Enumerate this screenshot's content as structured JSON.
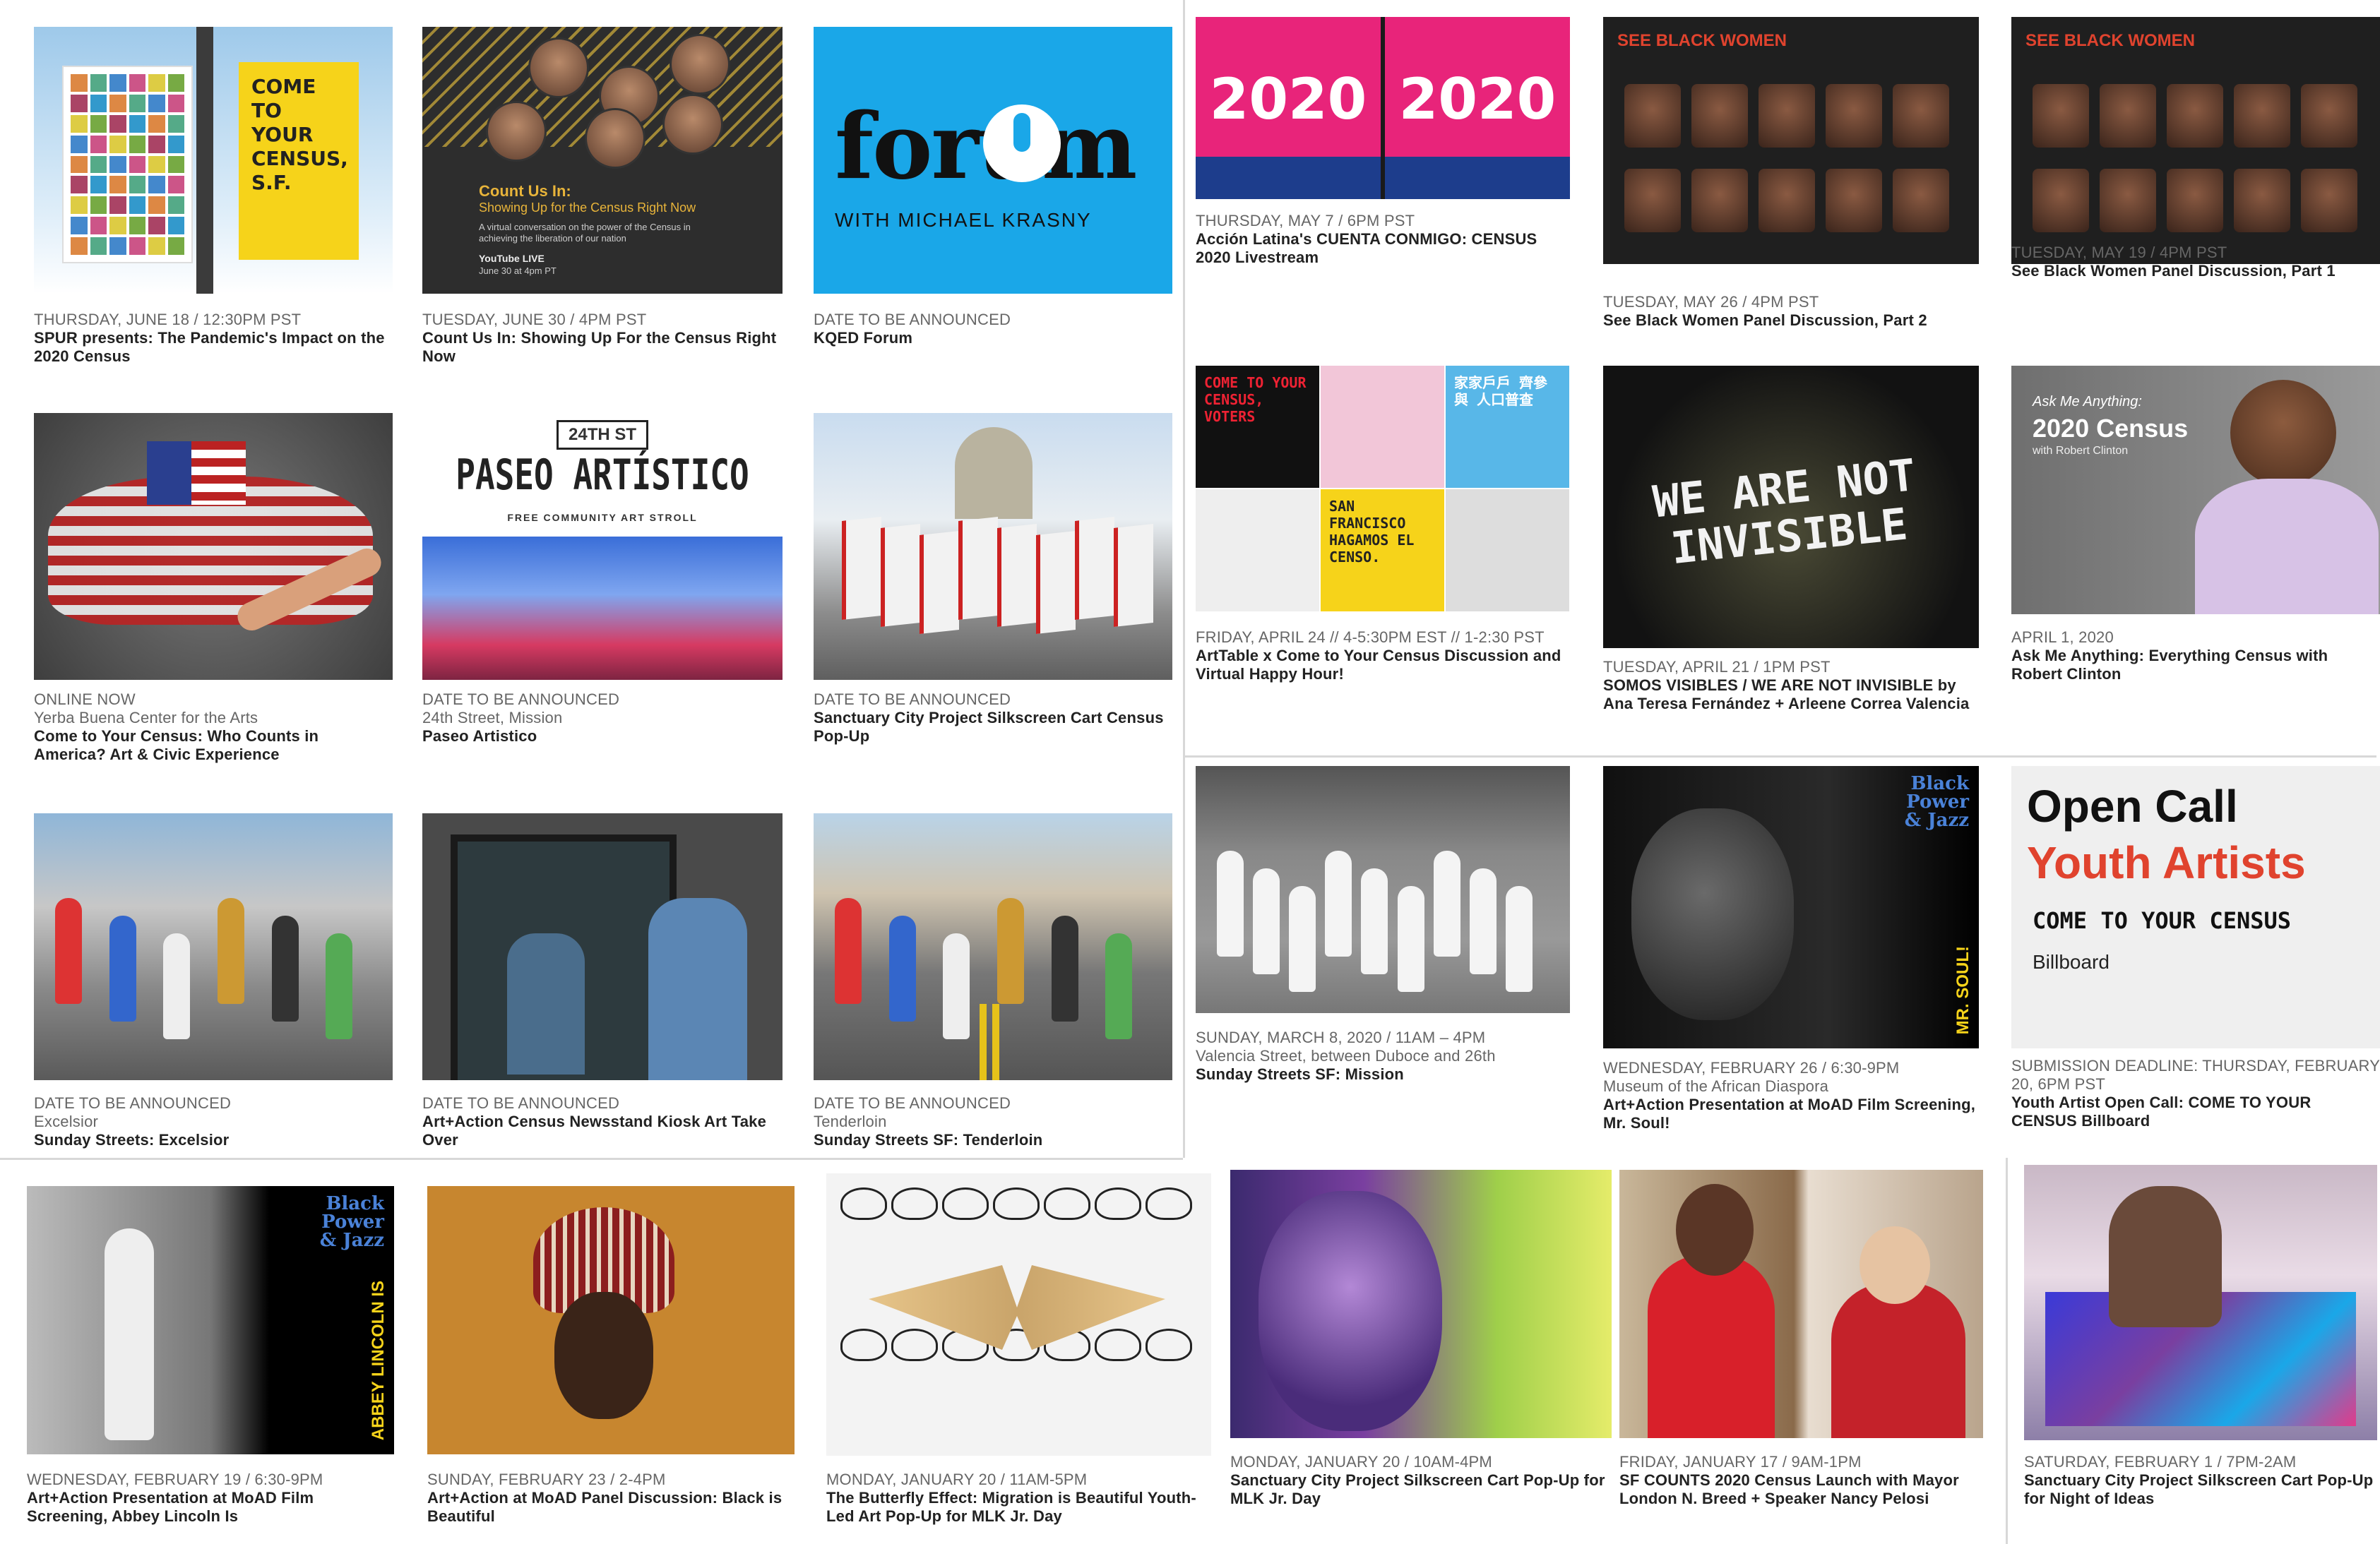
{
  "colors": {
    "kqed_blue": "#1aa7e8",
    "dark": "#2a2a2a",
    "pink": "#e02a6f",
    "yellow": "#f6d31a",
    "orange": "#c7862f"
  },
  "cards": [
    {
      "id": "spur",
      "date": "THURSDAY, JUNE 18 / 12:30PM PST",
      "loc": "",
      "title": "SPUR presents: The Pandemic's Impact on the 2020 Census",
      "thumb": {
        "type": "banner",
        "text": "COME TO YOUR CENSUS, S.F."
      }
    },
    {
      "id": "countus",
      "date": "TUESDAY, JUNE 30 / 4PM PST",
      "loc": "",
      "title": "Count Us In: Showing Up For the Census Right Now",
      "thumb": {
        "type": "countus",
        "heading": "Count Us In:",
        "sub": "Showing Up for the Census Right Now",
        "body": "A virtual conversation on the power of the Census in achieving the liberation of our nation",
        "footer1": "YouTube LIVE",
        "footer2": "June 30 at 4pm PT"
      }
    },
    {
      "id": "forum",
      "date": "DATE TO BE ANNOUNCED",
      "loc": "",
      "title": "KQED Forum",
      "thumb": {
        "type": "forum",
        "logo": "forum",
        "sub": "WITH MICHAEL KRASNY"
      }
    },
    {
      "id": "accion",
      "date": "THURSDAY, MAY 7 / 6PM PST",
      "loc": "",
      "title": "Acción Latina's CUENTA CONMIGO: CENSUS 2020 Livestream",
      "thumb": {
        "type": "accion",
        "text": "2020"
      }
    },
    {
      "id": "blackwomen2",
      "date": "TUESDAY, MAY 26 / 4PM PST",
      "loc": "",
      "title": "See Black Women Panel Discussion, Part 2",
      "thumb": {
        "type": "blackwomen",
        "heading": "SEE BLACK WOMEN"
      }
    },
    {
      "id": "blackwomen1",
      "date": "TUESDAY, MAY 19 / 4PM PST",
      "loc": "",
      "title": "See Black Women Panel Discussion, Part 1",
      "thumb": {
        "type": "blackwomen",
        "heading": "SEE BLACK WOMEN"
      }
    },
    {
      "id": "flags",
      "date": "ONLINE NOW",
      "loc": "Yerba Buena Center for the Arts",
      "title": "Come to Your Census: Who Counts in America? Art & Civic Experience",
      "thumb": {
        "type": "flags"
      }
    },
    {
      "id": "paseo",
      "date": "DATE TO BE ANNOUNCED",
      "loc": "24th Street, Mission",
      "title": "Paseo Artistico",
      "thumb": {
        "type": "paseo",
        "badge": "24TH ST",
        "heading": "PASEO ARTÍSTICO",
        "sub": "FREE COMMUNITY ART STROLL"
      }
    },
    {
      "id": "silkcart",
      "date": "DATE TO BE ANNOUNCED",
      "loc": "",
      "title": "Sanctuary City Project Silkscreen Cart Census Pop-Up",
      "thumb": {
        "type": "cityhall"
      }
    },
    {
      "id": "arttable",
      "date": "FRIDAY, APRIL 24 // 4-5:30PM EST // 1-2:30 PST",
      "loc": "",
      "title": "ArtTable x Come to Your Census Discussion and Virtual Happy Hour!",
      "thumb": {
        "type": "arttable",
        "t1": "COME TO YOUR CENSUS, VOTERS",
        "t2": "SAN FRANCISCO HAGAMOS EL CENSO.",
        "t3": "家家戶戶 齊參與 人口普查"
      }
    },
    {
      "id": "invisible",
      "date": "TUESDAY, APRIL 21 / 1PM PST",
      "loc": "",
      "title": "SOMOS VISIBLES / WE ARE NOT INVISIBLE by Ana Teresa Fernández + Arleene Correa Valencia",
      "thumb": {
        "type": "invisible",
        "text": "WE ARE NOT INVISIBLE"
      }
    },
    {
      "id": "ama",
      "date": "APRIL 1, 2020",
      "loc": "",
      "title": "Ask Me Anything: Everything Census with Robert Clinton",
      "thumb": {
        "type": "ama",
        "t1": "Ask Me Anything:",
        "t2": "2020 Census",
        "t3": "with Robert Clinton"
      }
    },
    {
      "id": "pedicab",
      "date": "DATE TO BE ANNOUNCED",
      "loc": "Excelsior",
      "title": "Sunday Streets: Excelsior",
      "thumb": {
        "type": "street1"
      }
    },
    {
      "id": "kiosk",
      "date": "DATE TO BE ANNOUNCED",
      "loc": "",
      "title": "Art+Action Census Newsstand Kiosk Art Take Over",
      "thumb": {
        "type": "kiosk"
      }
    },
    {
      "id": "tenderloin",
      "date": "DATE TO BE ANNOUNCED",
      "loc": "Tenderloin",
      "title": "Sunday Streets SF: Tenderloin",
      "thumb": {
        "type": "street2"
      }
    },
    {
      "id": "sundaymission",
      "date": "SUNDAY, MARCH 8, 2020 / 11AM – 4PM",
      "loc": "Valencia Street, between Duboce and 26th",
      "title": "Sunday Streets SF: Mission",
      "thumb": {
        "type": "dancers"
      }
    },
    {
      "id": "mrsoul",
      "date": "WEDNESDAY, FEBRUARY 26 / 6:30-9PM",
      "loc": "Museum of the African Diaspora",
      "title": "Art+Action Presentation at MoAD Film Screening, Mr. Soul!",
      "thumb": {
        "type": "mrsoul",
        "logo": "Black Power & Jazz",
        "side": "MR. SOUL!"
      }
    },
    {
      "id": "opencall",
      "date": "SUBMISSION DEADLINE: THURSDAY, FEBRUARY 20, 6PM PST",
      "loc": "",
      "title": "Youth Artist Open Call: COME TO YOUR CENSUS Billboard",
      "thumb": {
        "type": "opencall",
        "t1": "Open Call",
        "t2": "Youth Artists",
        "t3": "COME TO YOUR CENSUS",
        "t4": "Billboard"
      }
    },
    {
      "id": "abbey",
      "date": "WEDNESDAY, FEBRUARY 19 / 6:30-9PM",
      "loc": "",
      "title": "Art+Action Presentation at MoAD Film Screening, Abbey Lincoln Is",
      "thumb": {
        "type": "abbey",
        "logo": "Black Power & Jazz",
        "side": "ABBEY LINCOLN IS"
      }
    },
    {
      "id": "moadpanel",
      "date": "SUNDAY, FEBRUARY 23 / 2-4PM",
      "loc": "",
      "title": "Art+Action at MoAD Panel Discussion: Black is Beautiful",
      "thumb": {
        "type": "portrait"
      }
    },
    {
      "id": "butterfly",
      "date": "MONDAY, JANUARY 20 / 11AM-5PM",
      "loc": "",
      "title": "The Butterfly Effect: Migration is Beautiful Youth-Led Art Pop-Up for MLK Jr. Day",
      "thumb": {
        "type": "butterfly"
      }
    },
    {
      "id": "mlk",
      "date": "MONDAY, JANUARY 20 / 10AM-4PM",
      "loc": "",
      "title": "Sanctuary City Project Silkscreen Cart Pop-Up for MLK Jr. Day",
      "thumb": {
        "type": "mlk"
      }
    },
    {
      "id": "launch",
      "date": "FRIDAY, JANUARY 17 / 9AM-1PM",
      "loc": "",
      "title": "SF COUNTS 2020 Census Launch with Mayor London N. Breed + Speaker Nancy Pelosi",
      "thumb": {
        "type": "launch"
      }
    },
    {
      "id": "nightideas",
      "date": "SATURDAY, FEBRUARY 1 / 7PM-2AM",
      "loc": "",
      "title": "Sanctuary City Project Silkscreen Cart Pop-Up for Night of Ideas",
      "thumb": {
        "type": "silkscreen"
      }
    }
  ]
}
